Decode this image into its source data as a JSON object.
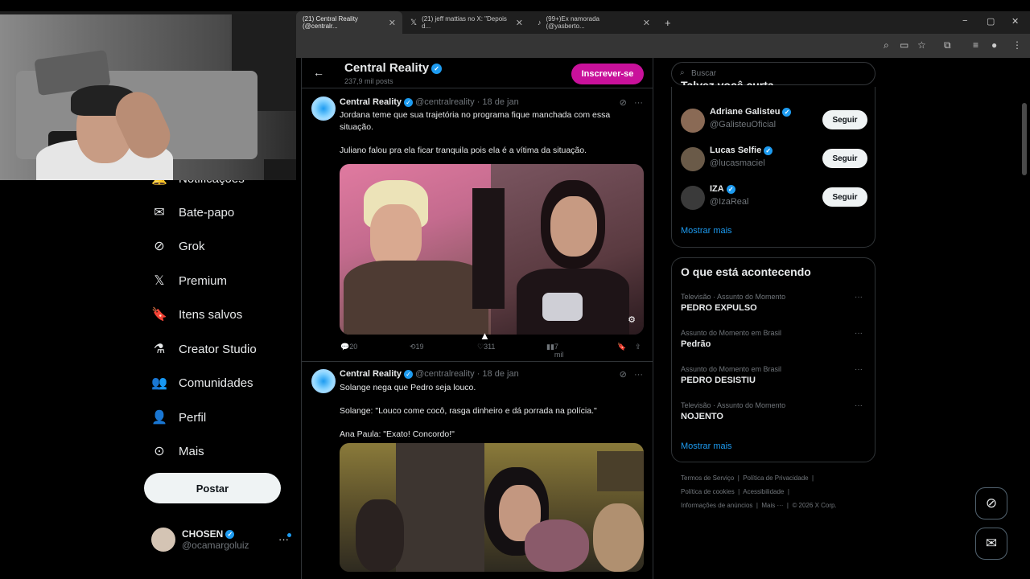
{
  "browser": {
    "tabs": [
      {
        "label": "(21) Central Reality (@centralr...",
        "active": true
      },
      {
        "label": "(21) jeff mattias no X: \"Depois d...",
        "active": false
      },
      {
        "label": "(99+)Ex namorada (@yasberto...",
        "active": false
      }
    ],
    "new_tab": "+",
    "controls": {
      "minimize": "−",
      "maximize": "▢",
      "close": "✕"
    },
    "toolbar_icons": [
      "zoom-icon",
      "cast-icon",
      "star-icon",
      "extensions-icon",
      "menu-icon"
    ]
  },
  "sidebar": {
    "items": [
      {
        "label": "Notificações",
        "icon": "bell-icon"
      },
      {
        "label": "Bate-papo",
        "icon": "mail-icon"
      },
      {
        "label": "Grok",
        "icon": "grok-icon"
      },
      {
        "label": "Premium",
        "icon": "x-icon"
      },
      {
        "label": "Itens salvos",
        "icon": "bookmark-icon"
      },
      {
        "label": "Creator Studio",
        "icon": "flask-icon"
      },
      {
        "label": "Comunidades",
        "icon": "people-icon"
      },
      {
        "label": "Perfil",
        "icon": "person-icon"
      },
      {
        "label": "Mais",
        "icon": "more-circle-icon"
      }
    ],
    "post_button": "Postar",
    "account": {
      "name": "CHOSEN",
      "handle": "@ocamargoluiz"
    }
  },
  "timeline": {
    "header": {
      "title": "Central Reality",
      "subtitle": "237,9 mil posts",
      "subscribe": "Inscrever-se"
    },
    "tweets": [
      {
        "author": "Central Reality",
        "handle": "@centralreality",
        "date": "18 de jan",
        "text_lines": [
          "Jordana teme que sua trajetória no programa fique manchada com essa",
          "situação.",
          "",
          "Juliano falou pra ela ficar tranquila pois ela é a vítima da situação."
        ],
        "stats": {
          "replies": "20",
          "reposts": "19",
          "likes": "311",
          "views": "7 mil"
        }
      },
      {
        "author": "Central Reality",
        "handle": "@centralreality",
        "date": "18 de jan",
        "text_lines": [
          "Solange nega que Pedro seja louco.",
          "",
          "Solange: \"Louco come cocô, rasga dinheiro e dá porrada na polícia.\"",
          "",
          "Ana Paula: \"Exato! Concordo!\""
        ]
      }
    ]
  },
  "right": {
    "search_placeholder": "Buscar",
    "who_to_follow": {
      "title": "Talvez você curta",
      "people": [
        {
          "name": "Adriane Galisteu",
          "handle": "@GalisteuOficial",
          "button": "Seguir",
          "avatar_color": "#8a6a55"
        },
        {
          "name": "Lucas Selfie",
          "handle": "@lucasmaciel",
          "button": "Seguir",
          "avatar_color": "#6a5a48"
        },
        {
          "name": "IZA",
          "handle": "@IzaReal",
          "button": "Seguir",
          "avatar_color": "#3a3a3a"
        }
      ],
      "more": "Mostrar mais"
    },
    "trends": {
      "title": "O que está acontecendo",
      "items": [
        {
          "context": "Televisão · Assunto do Momento",
          "topic": "PEDRO EXPULSO"
        },
        {
          "context": "Assunto do Momento em Brasil",
          "topic": "Pedrão"
        },
        {
          "context": "Assunto do Momento em Brasil",
          "topic": "PEDRO DESISTIU"
        },
        {
          "context": "Televisão · Assunto do Momento",
          "topic": "NOJENTO"
        }
      ],
      "more": "Mostrar mais"
    },
    "footer": {
      "line1": [
        "Termos de Serviço",
        "Política de Privacidade"
      ],
      "line2": [
        "Política de cookies",
        "Acessibilidade"
      ],
      "line3": [
        "Informações de anúncios",
        "Mais ···",
        "© 2026 X Corp."
      ]
    }
  },
  "colors": {
    "accent": "#1d9bf0",
    "subscribe": "#c9119b",
    "background": "#000000",
    "border": "#2f3336"
  }
}
